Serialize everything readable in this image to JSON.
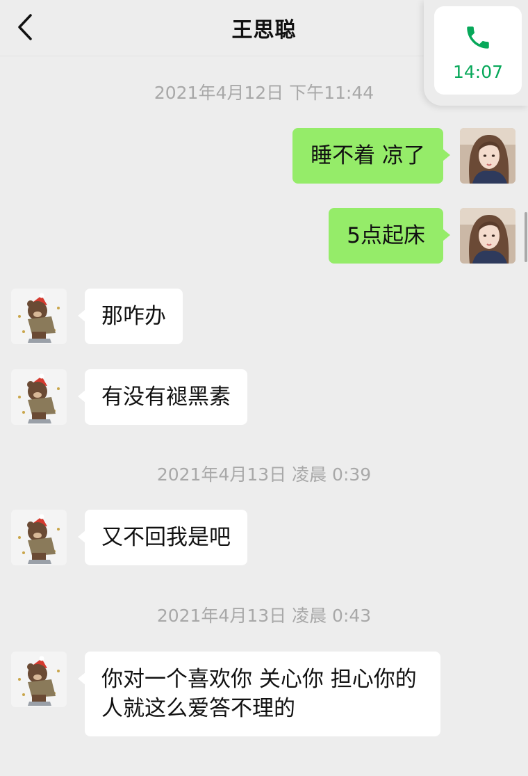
{
  "header": {
    "title": "王思聪",
    "back_icon": "chevron-left-icon"
  },
  "call_float": {
    "icon": "phone-icon",
    "time": "14:07",
    "color": "#07a85a"
  },
  "colors": {
    "background": "#ededed",
    "outgoing_bubble": "#95ec69",
    "incoming_bubble": "#ffffff",
    "timestamp_text": "#a8a8a8"
  },
  "messages": [
    {
      "type": "timestamp",
      "text": "2021年4月12日 下午11:44"
    },
    {
      "type": "message",
      "direction": "outgoing",
      "text": "睡不着 凉了"
    },
    {
      "type": "message",
      "direction": "outgoing",
      "text": "5点起床"
    },
    {
      "type": "message",
      "direction": "incoming",
      "text": "那咋办"
    },
    {
      "type": "message",
      "direction": "incoming",
      "text": "有没有褪黑素"
    },
    {
      "type": "timestamp",
      "text": "2021年4月13日 凌晨 0:39"
    },
    {
      "type": "message",
      "direction": "incoming",
      "text": "又不回我是吧"
    },
    {
      "type": "timestamp",
      "text": "2021年4月13日 凌晨 0:43"
    },
    {
      "type": "message",
      "direction": "incoming",
      "text": "你对一个喜欢你 关心你 担心你的人就这么爱答不理的"
    }
  ]
}
